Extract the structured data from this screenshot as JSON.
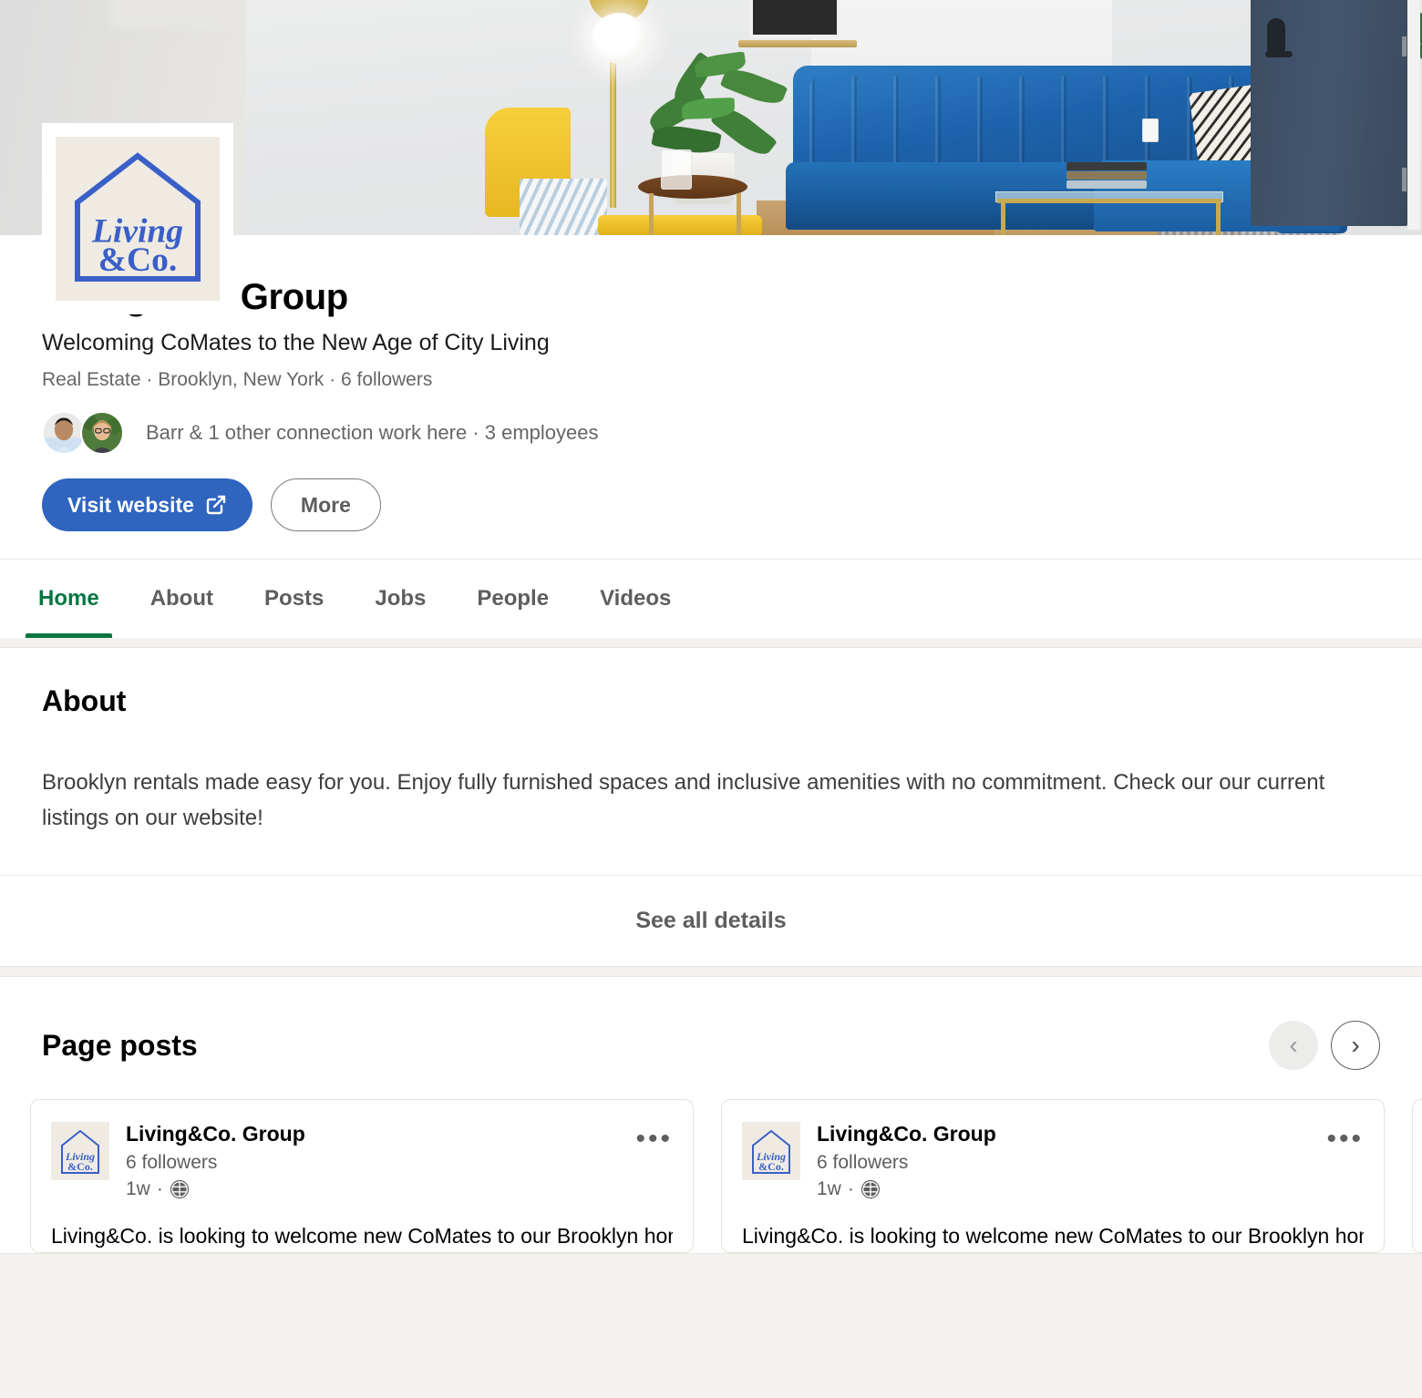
{
  "org": {
    "name": "Living&Co. Group",
    "tagline": "Welcoming CoMates to the New Age of City Living",
    "meta": "Real Estate · Brooklyn, New York · 6 followers",
    "connections": "Barr & 1 other connection work here · 3 employees",
    "logo_text_line1": "Living",
    "logo_text_line2": "&Co."
  },
  "actions": {
    "primary_label": "Visit website",
    "primary_icon": "external-link-icon",
    "secondary_label": "More"
  },
  "tabs": [
    {
      "label": "Home",
      "active": true
    },
    {
      "label": "About",
      "active": false
    },
    {
      "label": "Posts",
      "active": false
    },
    {
      "label": "Jobs",
      "active": false
    },
    {
      "label": "People",
      "active": false
    },
    {
      "label": "Videos",
      "active": false
    }
  ],
  "about": {
    "title": "About",
    "text": "Brooklyn rentals made easy for you. Enjoy fully furnished spaces and inclusive amenities with no commitment. Check our our current listings on our website!",
    "see_all_label": "See all details"
  },
  "posts": {
    "title": "Page posts",
    "prev_label": "‹",
    "next_label": "›",
    "items": [
      {
        "author": "Living&Co. Group",
        "followers": "6 followers",
        "time": "1w",
        "visibility_icon": "globe-icon",
        "menu_icon": "overflow-menu-icon",
        "body": "Living&Co. is looking to welcome new CoMates to our Brooklyn homes!"
      },
      {
        "author": "Living&Co. Group",
        "followers": "6 followers",
        "time": "1w",
        "visibility_icon": "globe-icon",
        "menu_icon": "overflow-menu-icon",
        "body": "Living&Co. is looking to welcome new CoMates to our Brooklyn homes!"
      }
    ]
  },
  "colors": {
    "accent_green": "#057642",
    "brand_blue": "#2f64bf",
    "logo_blue": "#3a5fc8",
    "page_bg": "#f4f2ee",
    "card_bg": "#ffffff",
    "muted_text": "#5e5e5e"
  }
}
